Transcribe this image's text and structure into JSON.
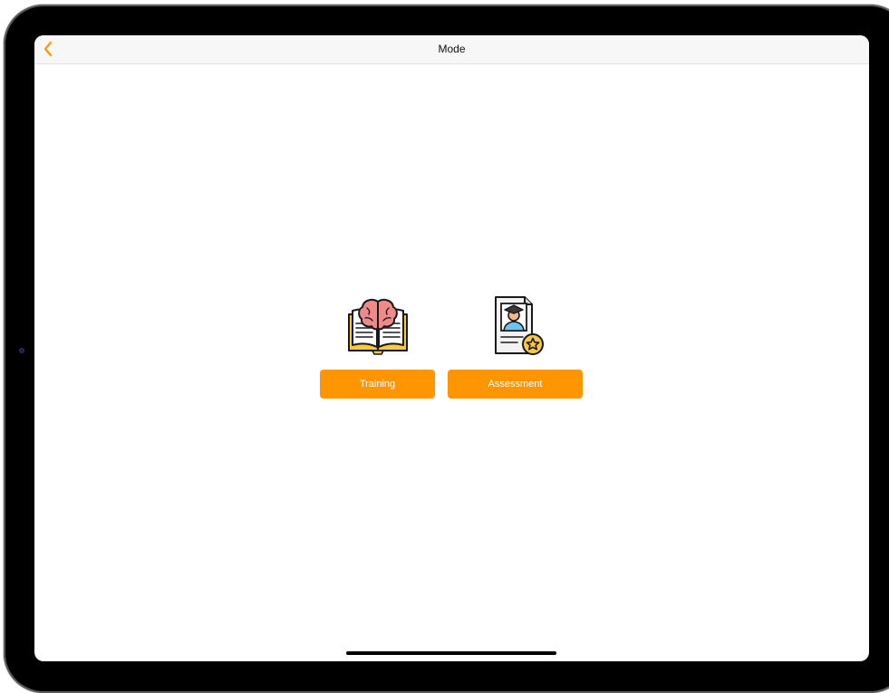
{
  "navbar": {
    "title": "Mode",
    "back_icon": "chevron-left-icon",
    "accent_color": "#ff9500"
  },
  "modes": [
    {
      "label": "Training",
      "icon": "brain-book-icon"
    },
    {
      "label": "Assessment",
      "icon": "graduate-certificate-icon"
    }
  ],
  "colors": {
    "button_bg": "#ff9500",
    "button_text": "#ffffff",
    "navbar_bg": "#f7f7f7"
  }
}
